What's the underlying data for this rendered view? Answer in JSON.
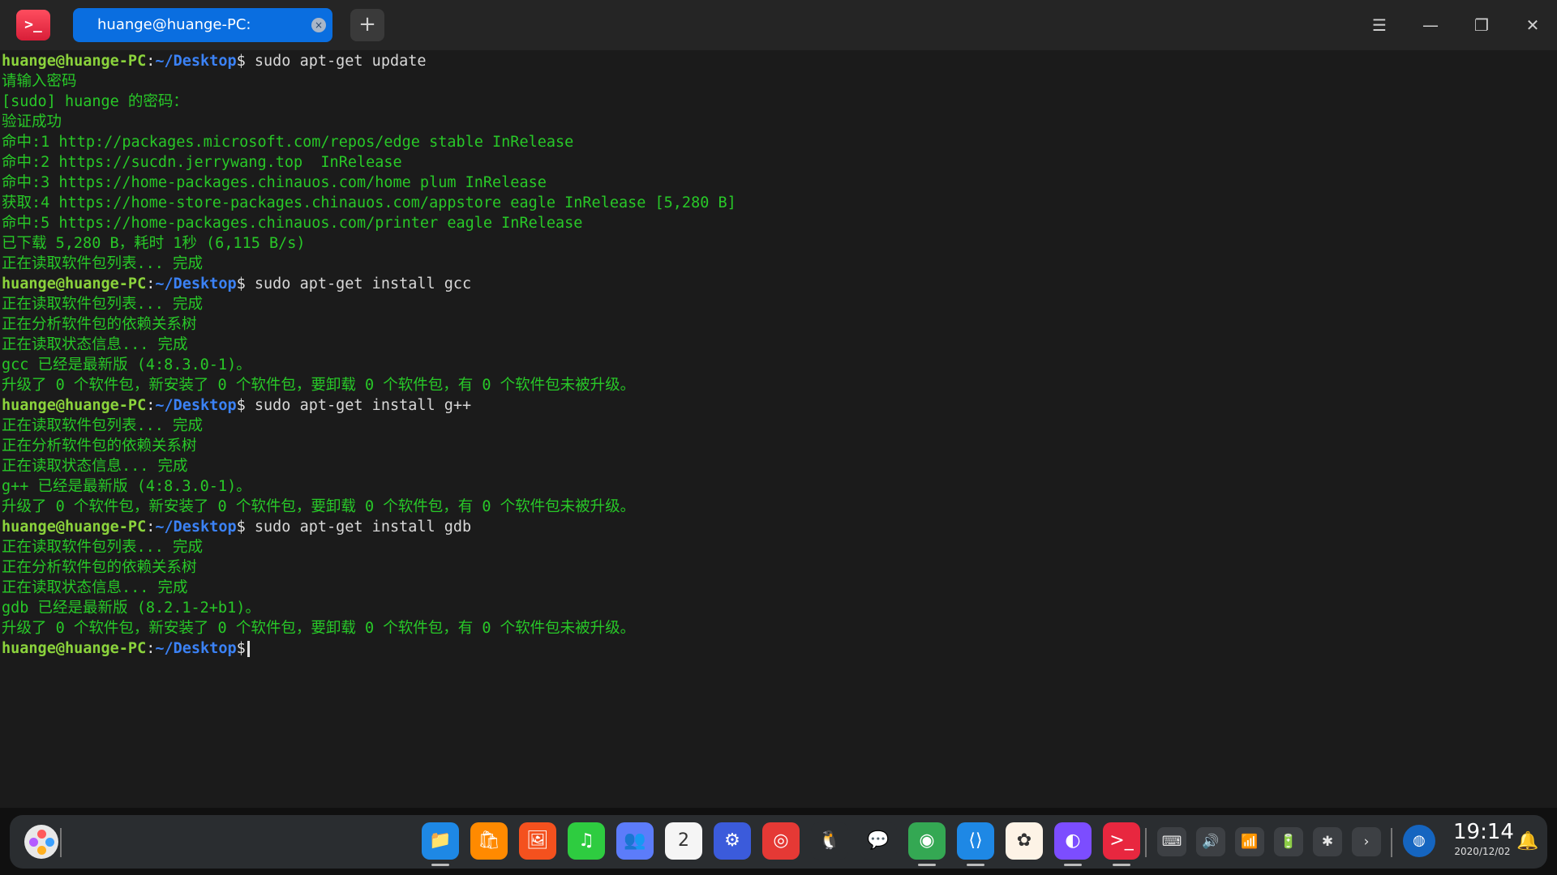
{
  "titlebar": {
    "app_icon": ">_",
    "tab_title": "huange@huange-PC: ~/Desktop",
    "tab_close": "×",
    "new_tab": "+",
    "menu": "☰",
    "minimize": "—",
    "maximize": "❐",
    "close": "✕"
  },
  "terminal": {
    "prompt": {
      "user": "huange@huange-PC",
      "sep": ":",
      "path": "~/Desktop",
      "dollar": "$"
    },
    "commands": [
      " sudo apt-get update",
      " sudo apt-get install gcc",
      " sudo apt-get install g++",
      " sudo apt-get install gdb"
    ],
    "output": [
      "请输入密码",
      "[sudo] huange 的密码：",
      "验证成功",
      "命中:1 http://packages.microsoft.com/repos/edge stable InRelease",
      "命中:2 https://sucdn.jerrywang.top  InRelease",
      "命中:3 https://home-packages.chinauos.com/home plum InRelease",
      "获取:4 https://home-store-packages.chinauos.com/appstore eagle InRelease [5,280 B]",
      "命中:5 https://home-packages.chinauos.com/printer eagle InRelease",
      "已下载 5,280 B，耗时 1秒 (6,115 B/s)",
      "正在读取软件包列表... 完成",
      "正在读取软件包列表... 完成",
      "正在分析软件包的依赖关系树",
      "正在读取状态信息... 完成",
      "gcc 已经是最新版 (4:8.3.0-1)。",
      "升级了 0 个软件包，新安装了 0 个软件包，要卸载 0 个软件包，有 0 个软件包未被升级。",
      "正在读取软件包列表... 完成",
      "正在分析软件包的依赖关系树",
      "正在读取状态信息... 完成",
      "g++ 已经是最新版 (4:8.3.0-1)。",
      "升级了 0 个软件包，新安装了 0 个软件包，要卸载 0 个软件包，有 0 个软件包未被升级。",
      "正在读取软件包列表... 完成",
      "正在分析软件包的依赖关系树",
      "正在读取状态信息... 完成",
      "gdb 已经是最新版 (8.2.1-2+b1)。",
      "升级了 0 个软件包，新安装了 0 个软件包，要卸载 0 个软件包，有 0 个软件包未被升级。"
    ]
  },
  "dock": {
    "apps": [
      {
        "name": "file-manager-icon",
        "glyph": "📁",
        "color": "#1e88e5"
      },
      {
        "name": "app-store-icon",
        "glyph": "🛍",
        "color": "#ff8a00"
      },
      {
        "name": "image-viewer-icon",
        "glyph": "🖼",
        "color": "#f4511e"
      },
      {
        "name": "music-icon",
        "glyph": "♫",
        "color": "#2ecc40"
      },
      {
        "name": "contacts-icon",
        "glyph": "👥",
        "color": "#5c7cfa"
      },
      {
        "name": "calendar-icon",
        "glyph": "2",
        "color": "#f5f5f5"
      },
      {
        "name": "control-center-icon",
        "glyph": "⚙",
        "color": "#3b5bdb"
      },
      {
        "name": "netease-music-icon",
        "glyph": "◎",
        "color": "#e53935"
      },
      {
        "name": "qq-icon",
        "glyph": "🐧",
        "color": "#2a2d30"
      },
      {
        "name": "wechat-icon",
        "glyph": "💬",
        "color": "#2a2d30"
      },
      {
        "name": "chrome-icon",
        "glyph": "◉",
        "color": "#34a853"
      },
      {
        "name": "vscode-icon",
        "glyph": "⟨⟩",
        "color": "#1e88e5"
      },
      {
        "name": "draw-icon",
        "glyph": "✿",
        "color": "#fdf3e6"
      },
      {
        "name": "browser-icon",
        "glyph": "◐",
        "color": "#7c4dff"
      },
      {
        "name": "terminal-icon",
        "glyph": ">_",
        "color": "#e8273f"
      }
    ],
    "tray": [
      {
        "name": "keyboard-icon",
        "glyph": "⌨"
      },
      {
        "name": "volume-icon",
        "glyph": "🔊"
      },
      {
        "name": "wifi-icon",
        "glyph": "📶"
      },
      {
        "name": "battery-icon",
        "glyph": "🔋"
      },
      {
        "name": "bluetooth-icon",
        "glyph": "✱"
      },
      {
        "name": "expand-tray-icon",
        "glyph": "›"
      }
    ],
    "clock": {
      "time": "19:14",
      "date": "2020/12/02"
    },
    "notification_glyph": "🔔"
  }
}
